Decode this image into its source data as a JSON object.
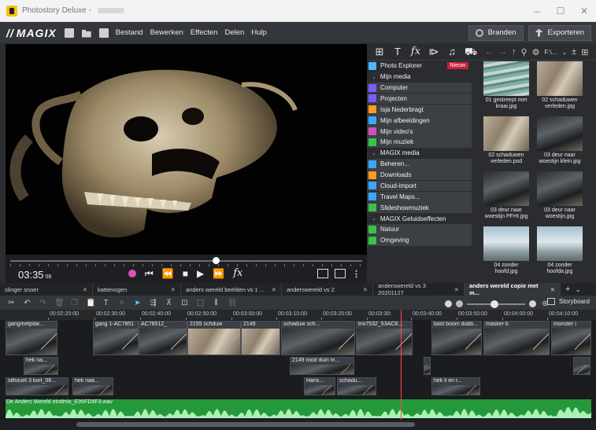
{
  "window": {
    "title": "Photostory Deluxe -"
  },
  "menu": {
    "logo": "MAGIX",
    "items": [
      "Bestand",
      "Bewerken",
      "Effecten",
      "Delen",
      "Hulp"
    ],
    "branden": "Branden",
    "exporteren": "Exporteren"
  },
  "transport": {
    "timecode": "03:35",
    "frames": "06",
    "scrub_position": 0.585
  },
  "media": {
    "path": "F:\\...",
    "tree": [
      {
        "label": "Photo Explorer",
        "type": "top",
        "color": "#4db8ff",
        "badge": "Nieuw"
      },
      {
        "label": "Mijn media",
        "type": "hdr"
      },
      {
        "label": "Computer",
        "type": "item",
        "color": "#7a5cff"
      },
      {
        "label": "Projecten",
        "type": "item",
        "color": "#7a5cff"
      },
      {
        "label": "Isja Nederbragt",
        "type": "item",
        "color": "#ff9a1f"
      },
      {
        "label": "Mijn afbeeldingen",
        "type": "item",
        "color": "#3aa8ff"
      },
      {
        "label": "Mijn video's",
        "type": "item",
        "color": "#d04fc5"
      },
      {
        "label": "Mijn muziek",
        "type": "item",
        "color": "#38c24a"
      },
      {
        "label": "MAGIX media",
        "type": "hdr"
      },
      {
        "label": "Beheren...",
        "type": "item",
        "color": "#3aa8ff"
      },
      {
        "label": "Downloads",
        "type": "item",
        "color": "#ff9a1f"
      },
      {
        "label": "Cloud-import",
        "type": "item",
        "color": "#3aa8ff"
      },
      {
        "label": "Travel Maps...",
        "type": "item",
        "color": "#3aa8ff"
      },
      {
        "label": "Slideshowmuziek",
        "type": "item",
        "color": "#38c24a"
      },
      {
        "label": "MAGIX Geluidseffecten",
        "type": "hdr"
      },
      {
        "label": "Natuur",
        "type": "item",
        "color": "#38c24a"
      },
      {
        "label": "Omgeving",
        "type": "item",
        "color": "#38c24a"
      }
    ],
    "thumbs": [
      {
        "caption": "01 gestreept met kraai.jpg",
        "style": "stripe"
      },
      {
        "caption": "02 schaduwen verleden.jpg",
        "style": "wall"
      },
      {
        "caption": "02 schaduwen verleden.psd",
        "style": "wall"
      },
      {
        "caption": "03 deur naar woestijn klein.jpg",
        "style": "dark"
      },
      {
        "caption": "03 deur naar woestijn PFHI.jpg",
        "style": "dark"
      },
      {
        "caption": "03 deur naar woestijn.jpg",
        "style": "dark"
      },
      {
        "caption": "04 zonder hoofd.jpg",
        "style": "sky"
      },
      {
        "caption": "04 zonder hoofda.jpg",
        "style": "sky"
      }
    ]
  },
  "timeline": {
    "tabs": [
      {
        "label": "slinger snoer",
        "width": 118
      },
      {
        "label": "kattenogen",
        "width": 112
      },
      {
        "label": "anders wereld beelden vs 1 ...",
        "width": 128
      },
      {
        "label": "anderswereld vs 2",
        "width": 116
      },
      {
        "label": "anderswereld vs 3 20201127",
        "width": 116
      },
      {
        "label": "anders wereld copie met m...",
        "width": 122,
        "active": true
      }
    ],
    "storyboard": "Storyboard",
    "ruler": [
      "00:02:20:00",
      "00:02:30:00",
      "00:02:40:00",
      "00:02:50:00",
      "00:03:00:00",
      "00:03:10:00",
      "00:03:20:00",
      "00:03:30:",
      "00:03:40:00",
      "00:03:50:00",
      "00:04:00:00",
      "00:04:10:00"
    ],
    "video_clips": [
      {
        "label": "gangmetpilar...",
        "style": "dark"
      },
      {
        "label": "gang 1-AC7851",
        "style": "dark"
      },
      {
        "label": "AC78512_",
        "style": "dark"
      },
      {
        "label": "2155 schduw",
        "style": "wall"
      },
      {
        "label": "2149",
        "style": "wall"
      },
      {
        "label": "schaduw sch...",
        "style": "dark"
      },
      {
        "label": "trix7532_53AC8...",
        "style": "dark"
      },
      {
        "label": "bast boom dubb...",
        "style": "dark"
      },
      {
        "label": "masker b",
        "style": "dark"
      },
      {
        "label": "monster i",
        "style": "dark"
      }
    ],
    "overlay_clips": [
      {
        "label": "hek na..."
      },
      {
        "label": "2149 rood duin m..."
      },
      {
        "label": ""
      },
      {
        "label": ""
      }
    ],
    "lower_clips": [
      {
        "label": "silhouet 3 kort_06..."
      },
      {
        "label": "hek naa..."
      },
      {
        "label": "Hans..."
      },
      {
        "label": "schadu..."
      },
      {
        "label": "hek li en r..."
      }
    ],
    "audio_label": "De Anders Wereld eindmix_E95FD9F3.wav"
  }
}
